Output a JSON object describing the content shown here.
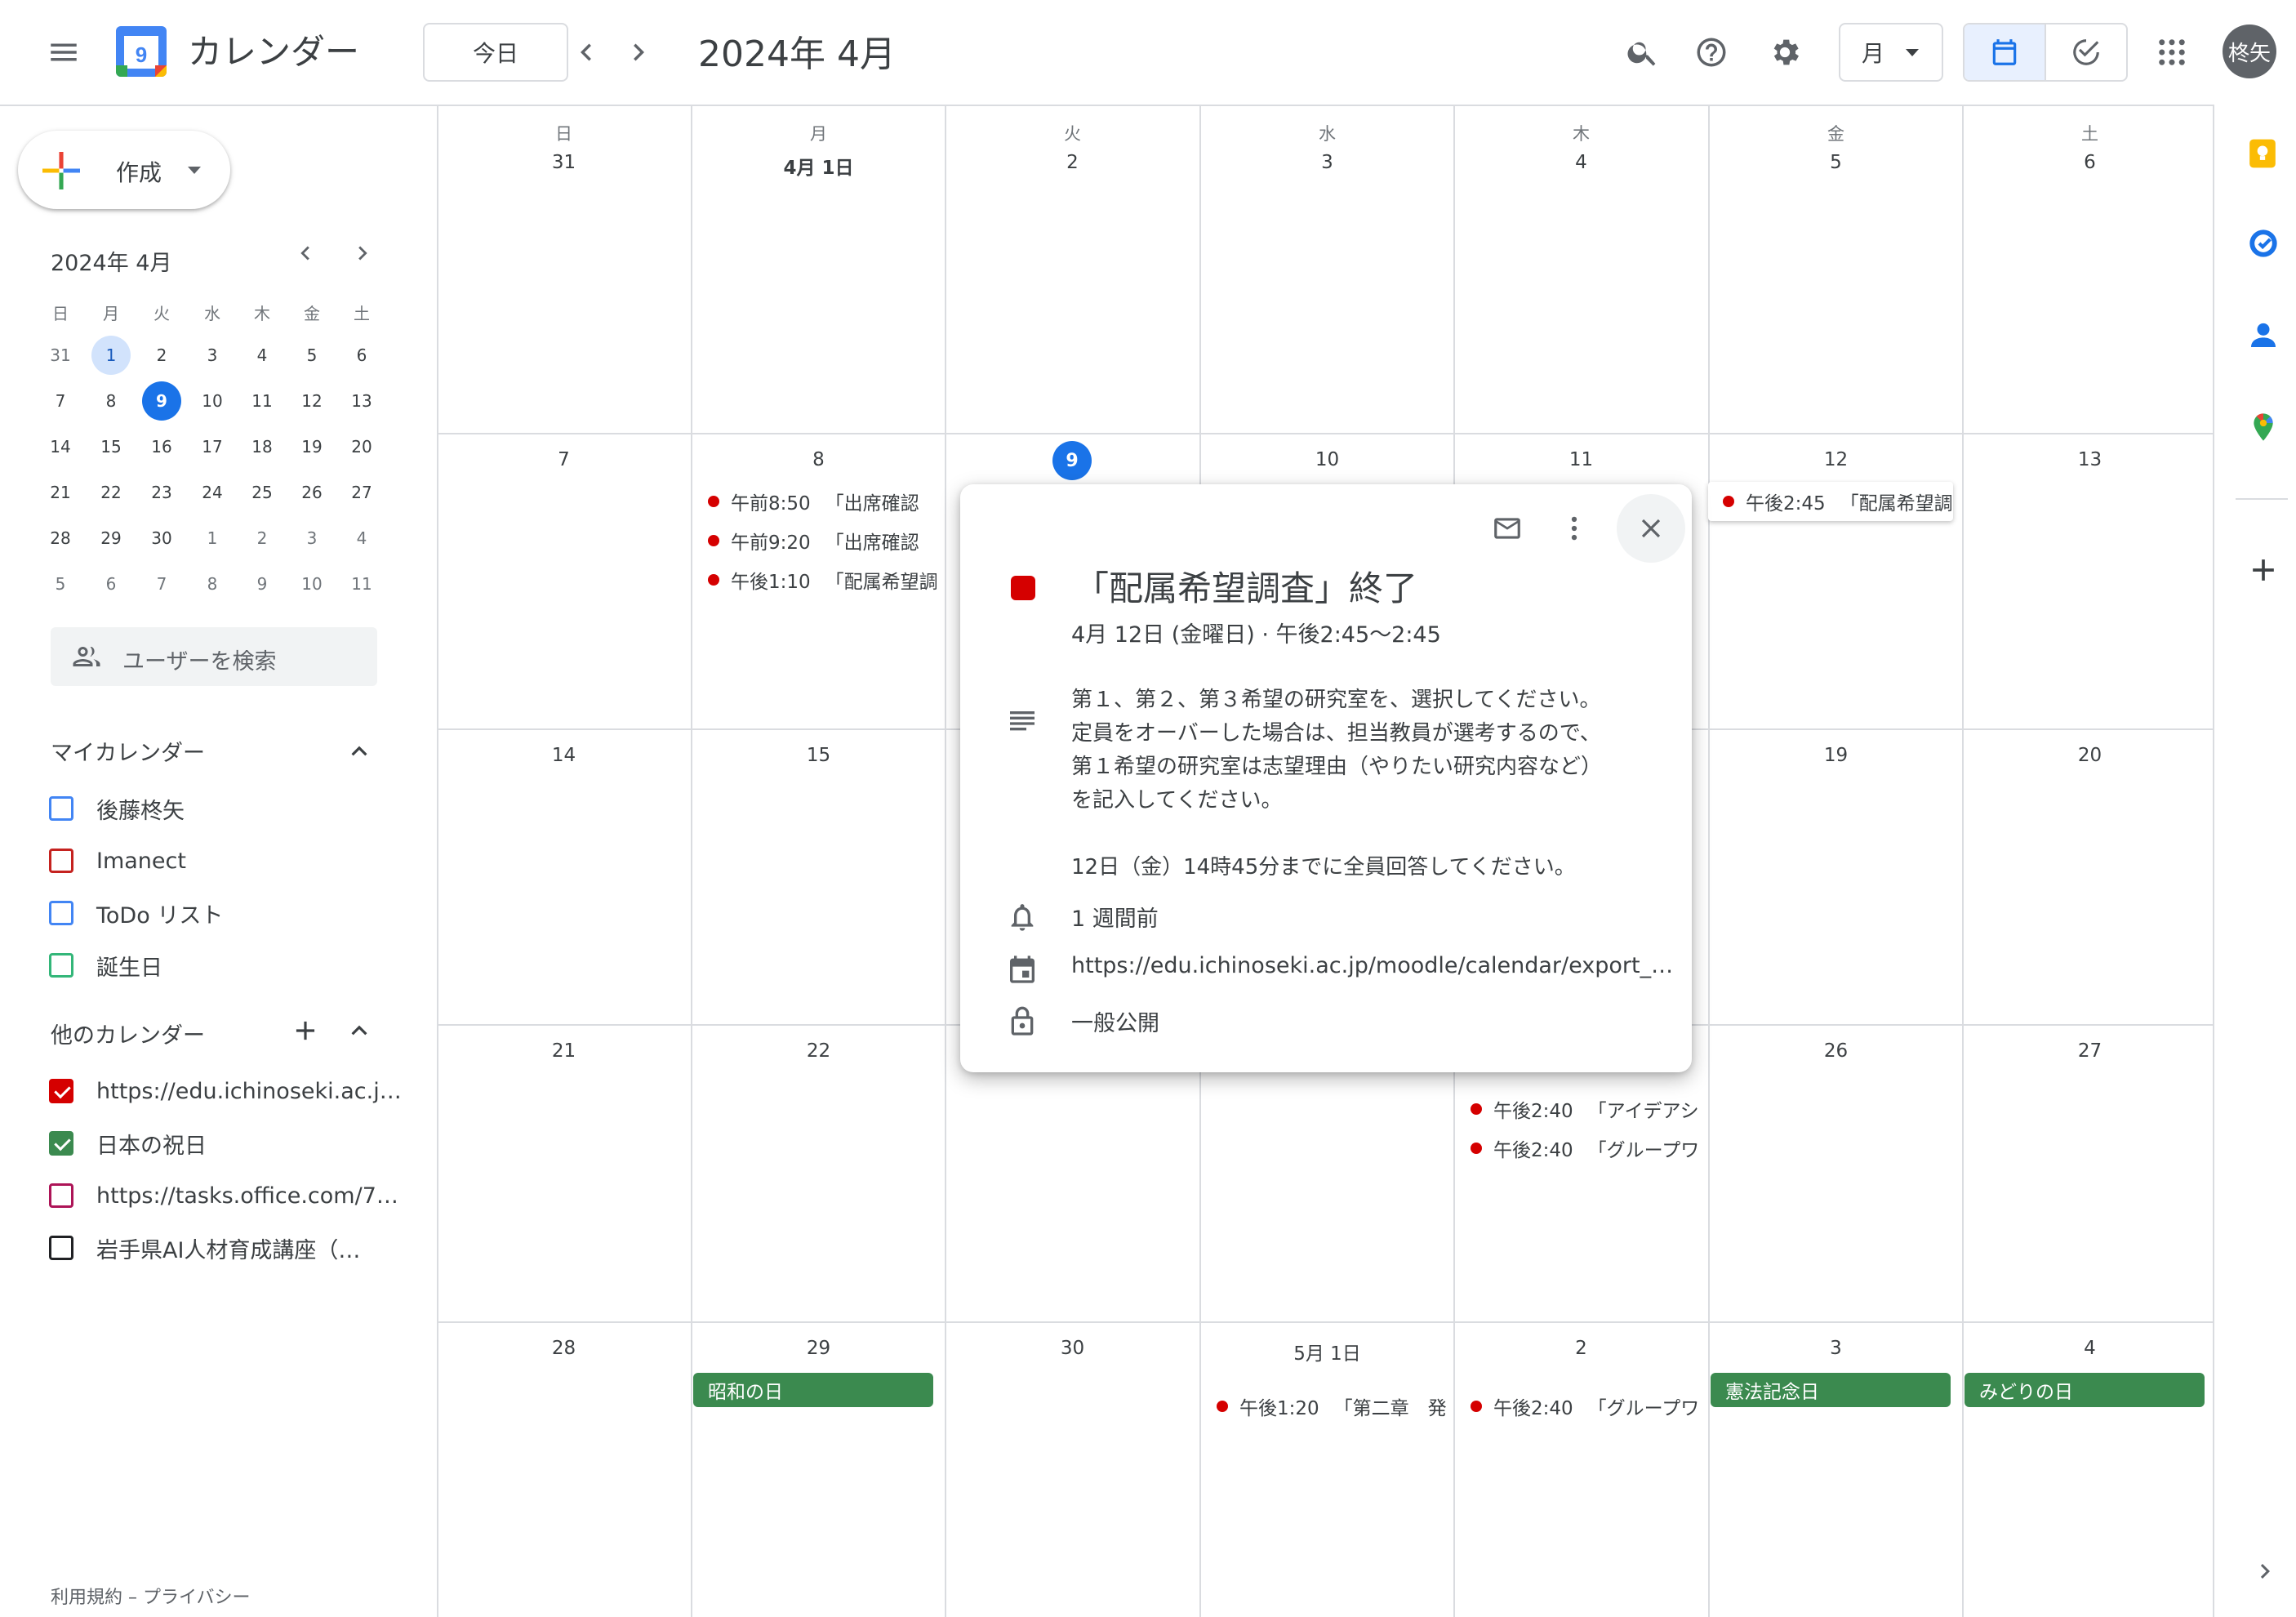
{
  "header": {
    "app_title": "カレンダー",
    "logo_day": "9",
    "today_button": "今日",
    "current_period": "2024年 4月",
    "view_select": "月",
    "avatar_text": "柊矢",
    "colors": {
      "accent": "#1a73e8",
      "logo_blue": "#4285f4"
    }
  },
  "sidebar": {
    "create_label": "作成",
    "mini_calendar": {
      "title": "2024年 4月",
      "weekdays": [
        "日",
        "月",
        "火",
        "水",
        "木",
        "金",
        "土"
      ],
      "weeks": [
        [
          "31",
          "1",
          "2",
          "3",
          "4",
          "5",
          "6"
        ],
        [
          "7",
          "8",
          "9",
          "10",
          "11",
          "12",
          "13"
        ],
        [
          "14",
          "15",
          "16",
          "17",
          "18",
          "19",
          "20"
        ],
        [
          "21",
          "22",
          "23",
          "24",
          "25",
          "26",
          "27"
        ],
        [
          "28",
          "29",
          "30",
          "1",
          "2",
          "3",
          "4"
        ],
        [
          "5",
          "6",
          "7",
          "8",
          "9",
          "10",
          "11"
        ]
      ],
      "today": "9",
      "selected": "1"
    },
    "user_search_placeholder": "ユーザーを検索",
    "my_calendars_title": "マイカレンダー",
    "my_calendars": [
      {
        "label": "後藤柊矢",
        "color": "#4285f4",
        "checked": false
      },
      {
        "label": "Imanect",
        "color": "#c5221f",
        "checked": false
      },
      {
        "label": "ToDo リスト",
        "color": "#4285f4",
        "checked": false
      },
      {
        "label": "誕生日",
        "color": "#33b679",
        "checked": false
      }
    ],
    "other_calendars_title": "他のカレンダー",
    "other_calendars": [
      {
        "label": "https://edu.ichinoseki.ac.j…",
        "color": "#d50000",
        "checked": true
      },
      {
        "label": "日本の祝日",
        "color": "#3b8a4f",
        "checked": true
      },
      {
        "label": "https://tasks.office.com/7…",
        "color": "#ad1457",
        "checked": false
      },
      {
        "label": "岩手県AI人材育成講座（…",
        "color": "#202124",
        "checked": false
      }
    ],
    "footer": "利用規約 – プライバシー"
  },
  "grid": {
    "weekdays": [
      "日",
      "月",
      "火",
      "水",
      "木",
      "金",
      "土"
    ],
    "weeks": [
      {
        "days": [
          "31",
          "4月 1日",
          "2",
          "3",
          "4",
          "5",
          "6"
        ]
      },
      {
        "days": [
          "7",
          "8",
          "9",
          "10",
          "11",
          "12",
          "13"
        ]
      },
      {
        "days": [
          "14",
          "15",
          "16",
          "17",
          "18",
          "19",
          "20"
        ]
      },
      {
        "days": [
          "21",
          "22",
          "23",
          "24",
          "25",
          "26",
          "27"
        ]
      },
      {
        "days": [
          "28",
          "29",
          "30",
          "5月 1日",
          "2",
          "3",
          "4"
        ]
      }
    ],
    "events": {
      "w1_mon_1": {
        "time": "午前8:50",
        "title": "「出席確認"
      },
      "w1_mon_2": {
        "time": "午前9:20",
        "title": "「出席確認"
      },
      "w1_mon_3": {
        "time": "午後1:10",
        "title": "「配属希望調"
      },
      "w1_fri_1": {
        "time": "午後2:45",
        "title": "「配属希望調"
      },
      "w3_thu_1": {
        "time": "午後2:40",
        "title": "「アイデアシ"
      },
      "w3_thu_2": {
        "time": "午後2:40",
        "title": "「グループワ"
      },
      "w4_wed_1": {
        "time": "午後1:20",
        "title": "「第二章　発"
      },
      "w4_thu_1": {
        "time": "午後2:40",
        "title": "「グループワ"
      }
    },
    "holidays": {
      "showa": "昭和の日",
      "kenpo": "憲法記念日",
      "midori": "みどりの日"
    },
    "event_color": "#d50000",
    "holiday_color": "#3b8a4f"
  },
  "popup": {
    "title": "「配属希望調査」終了",
    "when": "4月 12日 (金曜日)  ·  午後2:45～2:45",
    "description_lines": [
      "第１、第２、第３希望の研究室を、選択してください。",
      "定員をオーバーした場合は、担当教員が選考するので、",
      "第１希望の研究室は志望理由（やりたい研究内容など）",
      "を記入してください。",
      "",
      "12日（金）14時45分までに全員回答してください。"
    ],
    "reminder": "1 週間前",
    "calendar_link": "https://edu.ichinoseki.ac.jp/moodle/calendar/export_e…",
    "visibility": "一般公開",
    "color": "#d50000"
  }
}
